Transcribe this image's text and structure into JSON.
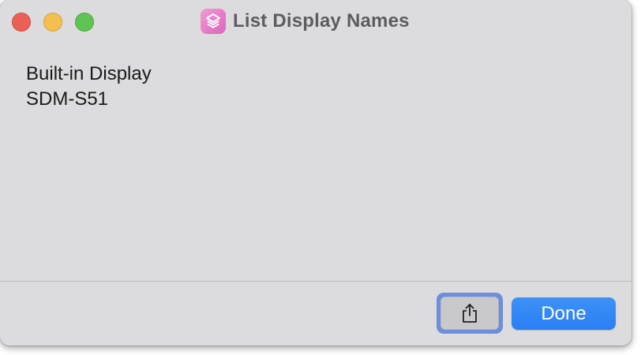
{
  "window": {
    "title": "List Display Names",
    "app_icon": "shortcuts-icon"
  },
  "traffic_lights": {
    "close_color": "#ec5f57",
    "minimize_color": "#f4bf4f",
    "zoom_color": "#5fc454"
  },
  "result": {
    "lines": [
      "Built-in Display",
      "SDM-S51"
    ]
  },
  "footer": {
    "share_icon": "share-icon",
    "done_label": "Done",
    "accent_color": "#2a7ff3"
  }
}
